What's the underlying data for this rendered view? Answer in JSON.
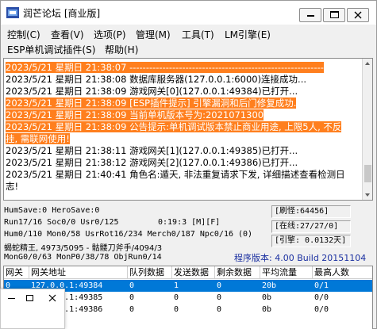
{
  "window": {
    "title": "润芒论坛 [商业版]",
    "controls": {
      "minimize": "—",
      "maximize": "□",
      "close": "✕"
    }
  },
  "menu": {
    "row1": [
      "控制(C)",
      "查看(V)",
      "选项(P)",
      "管理(M)",
      "工具(T)",
      "LM引擎(E)"
    ],
    "row2": [
      "ESP单机调试插件(S)",
      "帮助(H)"
    ]
  },
  "log": {
    "lines": [
      {
        "text": "2023/5/21  星期日  21:38:07  -----------------------------------------------------------",
        "highlight": true
      },
      {
        "text": "2023/5/21  星期日  21:38:08  数据库服务器(127.0.0.1:6000)连接成功...",
        "highlight": false
      },
      {
        "text": "2023/5/21  星期日  21:38:09  游戏网关[0](127.0.0.1:49384)已打开...",
        "highlight": false
      },
      {
        "text": "2023/5/21  星期日  21:38:09  [ESP插件提示] 引擎漏洞和后门修复成功.",
        "highlight": true
      },
      {
        "text": "2023/5/21  星期日  21:38:09  当前单机版本号为:2021071300",
        "highlight": true
      },
      {
        "text": "2023/5/21  星期日  21:38:09  公告提示:单机调试版本禁止商业用途, 上限5人, 不反",
        "highlight": true
      },
      {
        "text": "挂, 需联网使用!",
        "highlight": true
      },
      {
        "text": "2023/5/21  星期日  21:38:11  游戏网关[1](127.0.0.1:49385)已打开...",
        "highlight": false
      },
      {
        "text": "2023/5/21  星期日  21:38:12  游戏网关[2](127.0.0.1:49386)已打开...",
        "highlight": false
      },
      {
        "text": "2023/5/21  星期日  21:40:41  角色名:遁天, 非法重复请求下发, 详细描述查看检测日",
        "highlight": false
      },
      {
        "text": "志!",
        "highlight": false
      }
    ]
  },
  "status": {
    "line1": "HumSave:0 HeroSave:0",
    "line2": "Run17/16 Soc0/0 Usr0/125",
    "timer": "0:19:3 [M][F]",
    "line3": "Hum0/110 Mon0/58 UsrRot16/234 Merch0/187 Npc0/16 (0)",
    "line4": "蝎蛇精王, 4973/5095 - 骷髅刀斧手/4094/3",
    "line5": "MonG0/0/63 MonP0/38/78 ObjRun0/14",
    "refresh": "[刷怪:64456]",
    "online": "[在线:27/27/0]",
    "engine": "[引擎: 0.0132天]",
    "version": "程序版本: 4.00 Build 20151104"
  },
  "table": {
    "headers": [
      "网关",
      "网关地址",
      "队列数据",
      "发送数据",
      "剩余数据",
      "平均流量",
      "最高人数"
    ],
    "rows": [
      [
        "0",
        "127.0.0.1:49384",
        "0",
        "1",
        "0",
        "20b",
        "0/1"
      ],
      [
        "1",
        "127.0.0.1:49385",
        "0",
        "0",
        "0",
        "0b",
        "0/0"
      ],
      [
        "2",
        "127.0.0.1:49386",
        "0",
        "0",
        "0",
        "0b",
        "0/0"
      ]
    ],
    "selected_row": 0
  },
  "mini_window": {
    "minimize": "—",
    "maximize": "□",
    "close": "✕"
  }
}
